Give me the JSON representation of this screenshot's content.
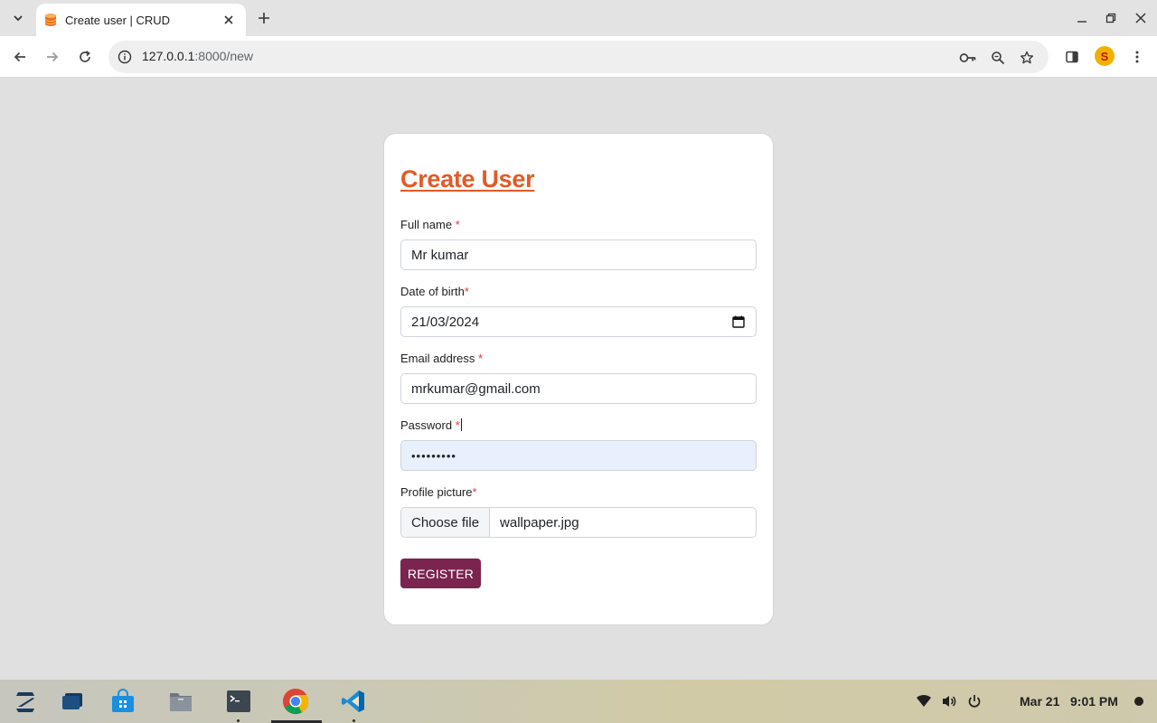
{
  "browser": {
    "tab_title": "Create user | CRUD",
    "url_host": "127.0.0.1",
    "url_path": ":8000/new"
  },
  "form": {
    "title": "Create User",
    "fields": [
      {
        "label": "Full name",
        "required_mark": " *",
        "value": "Mr kumar"
      },
      {
        "label": "Date of birth",
        "required_mark": "*",
        "value": "21/03/2024"
      },
      {
        "label": "Email address",
        "required_mark": " *",
        "value": "mrkumar@gmail.com"
      },
      {
        "label": "Password",
        "required_mark": " *",
        "value": "•••••••••"
      },
      {
        "label": "Profile picture",
        "required_mark": "*",
        "button": "Choose file",
        "value": "wallpaper.jpg"
      }
    ],
    "submit_label": "REGISTER"
  },
  "taskbar": {
    "date": "Mar 21",
    "time": "9:01 PM"
  },
  "colors": {
    "title_accent": "#e35a26",
    "button_bg": "#7b2450",
    "required": "#dc3545",
    "autofill_bg": "#e8f0fe"
  }
}
